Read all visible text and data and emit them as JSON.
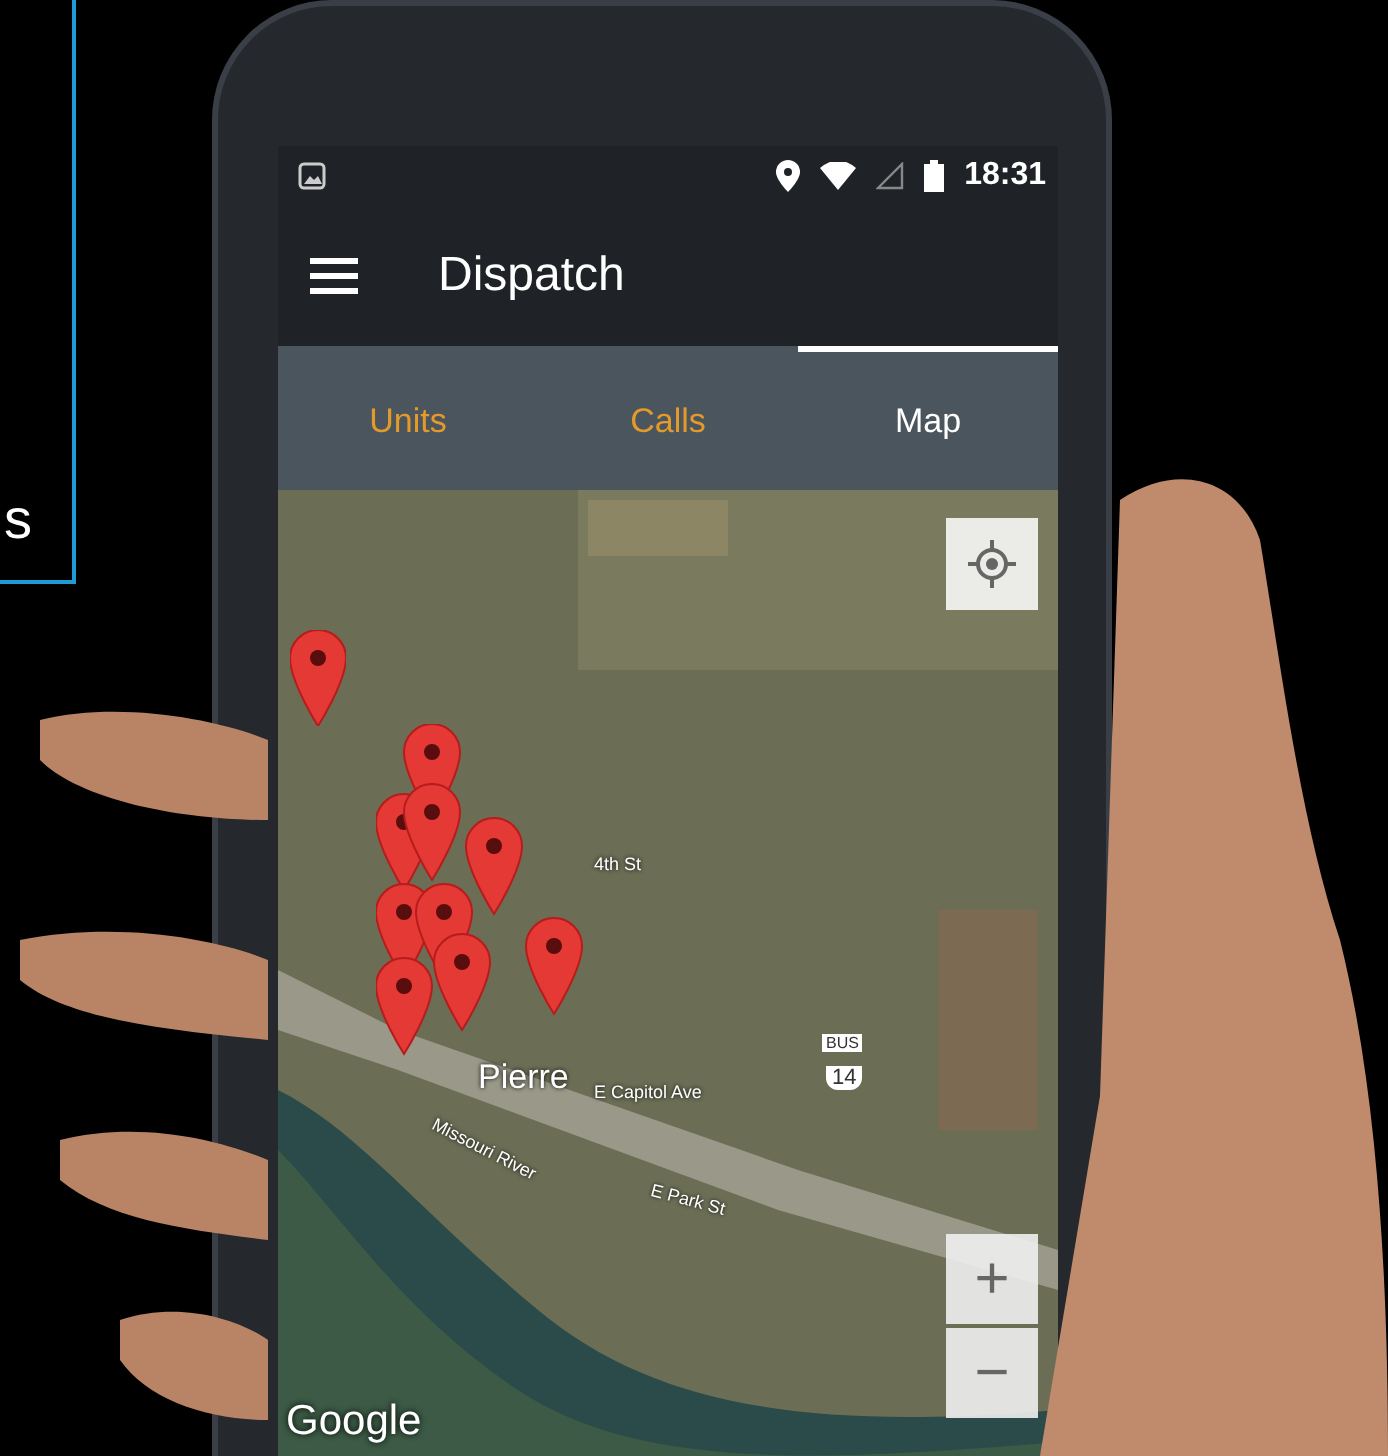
{
  "side_panel": {
    "text": "s"
  },
  "status_bar": {
    "time": "18:31"
  },
  "app_bar": {
    "title": "Dispatch"
  },
  "tabs": [
    {
      "label": "Units",
      "selected": false
    },
    {
      "label": "Calls",
      "selected": false
    },
    {
      "label": "Map",
      "selected": true
    }
  ],
  "map": {
    "labels": [
      "4th St",
      "Pierre",
      "E Capitol Ave",
      "Missouri River",
      "E Park St",
      "BUS",
      "14"
    ],
    "zoom_in": "+",
    "zoom_out": "−",
    "attribution": "Google"
  }
}
